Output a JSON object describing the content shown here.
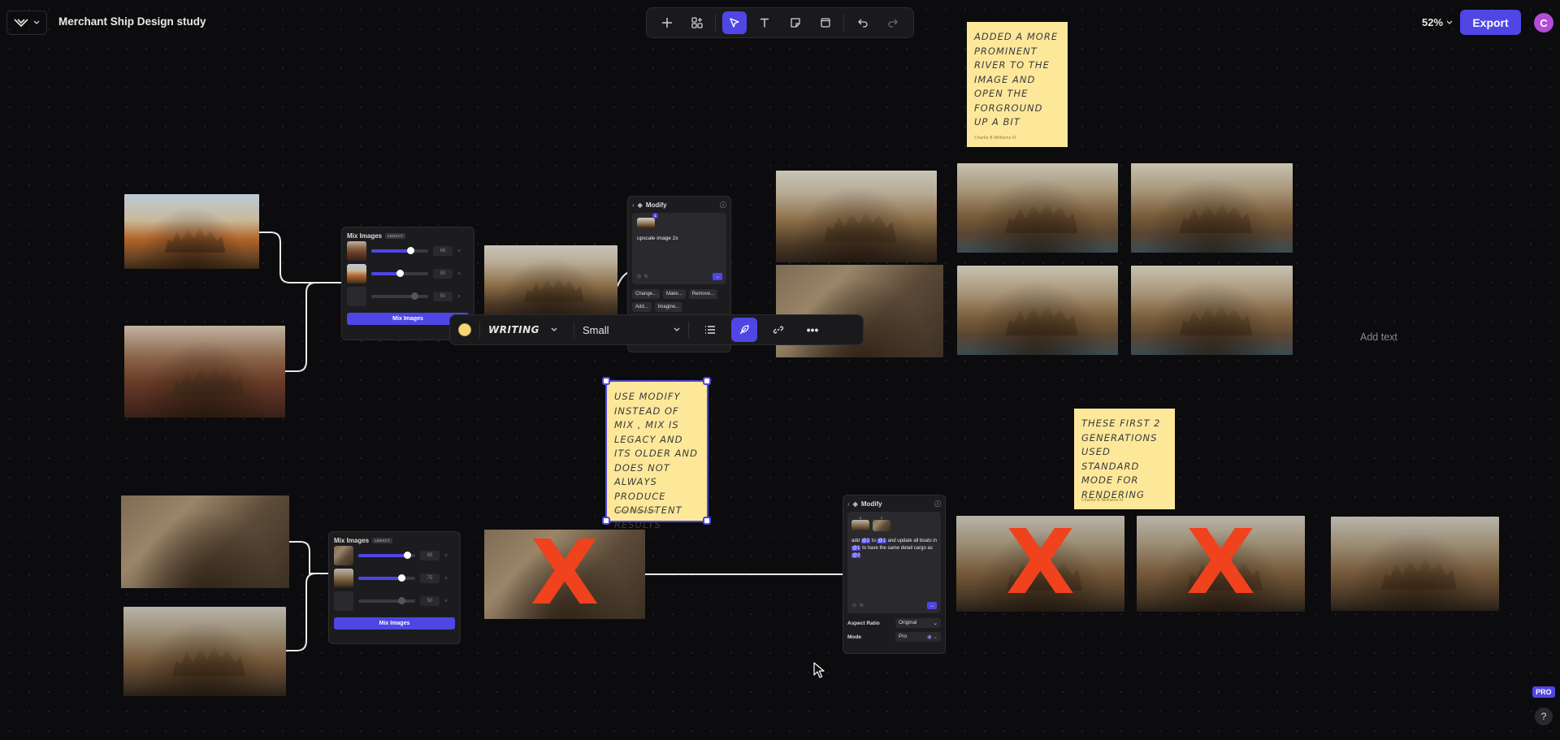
{
  "app": {
    "document_title": "Merchant Ship Design study",
    "zoom": "52%",
    "export_label": "Export",
    "avatar_initial": "C",
    "pro_badge": "PRO",
    "help_label": "?",
    "add_text_placeholder": "Add text"
  },
  "toolbar": {
    "tools": [
      "plus-icon",
      "components-icon",
      "pointer-icon",
      "text-icon",
      "sticky-note-icon",
      "frame-icon",
      "undo-icon",
      "redo-icon"
    ],
    "active": "pointer-icon"
  },
  "format_bar": {
    "color": "#f7d774",
    "font": "WRITING",
    "size": "Small"
  },
  "mix_panel_top": {
    "title": "Mix Images",
    "badge": "LEGACY",
    "rows": [
      {
        "value": "68",
        "weight": 0.68
      },
      {
        "value": "50",
        "weight": 0.5
      },
      {
        "value": "50",
        "weight": 0.0
      }
    ],
    "button_label": "Mix Images"
  },
  "mix_panel_bottom": {
    "title": "Mix Images",
    "badge": "LEGACY",
    "rows": [
      {
        "value": "85",
        "weight": 0.85
      },
      {
        "value": "75",
        "weight": 0.75
      },
      {
        "value": "50",
        "weight": 0.0
      }
    ],
    "button_label": "Mix Images"
  },
  "modify_panel_top": {
    "title": "Modify",
    "badge_number": "1",
    "prompt": "upscale image 2x",
    "chips": [
      "Change...",
      "Make...",
      "Remove...",
      "Add...",
      "Imagine..."
    ]
  },
  "modify_panel_bottom": {
    "title": "Modify",
    "ref_numbers": [
      "1",
      "2"
    ],
    "prompt_parts": [
      "add ",
      "@2",
      " to ",
      "@1",
      " and update all boats in ",
      "@1",
      " to have the same detail cargo as ",
      "@2"
    ],
    "aspect_ratio_label": "Aspect Ratio",
    "aspect_ratio_value": "Original",
    "mode_label": "Mode",
    "mode_value": "Pro"
  },
  "stickies": {
    "river": {
      "text": "ADDED A MORE PROMINENT RIVER TO THE IMAGE AND OPEN THE FORGROUND UP A BIT",
      "author": "Charlie B Williams III"
    },
    "modify": {
      "text": "USE MODIFY INSTEAD OF MIX , MIX IS LEGACY AND ITS OLDER AND DOES NOT ALWAYS PRODUCE CONSISTENT RESULTS",
      "author": "Charlie B Williams III"
    },
    "standard": {
      "text": "THESE FIRST 2 GENERATIONS USED STANDARD MODE FOR RENDERING",
      "author": "Charlie B Williams III"
    }
  },
  "marks": {
    "rejected": "X"
  }
}
